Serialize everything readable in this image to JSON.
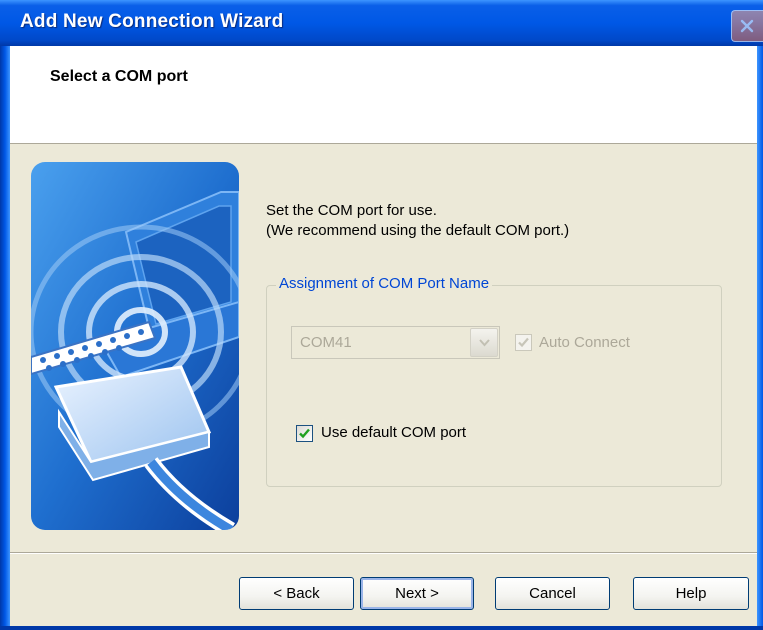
{
  "window": {
    "title": "Add New Connection Wizard",
    "accent_color": "#0058e6",
    "icons": {
      "close": "close-icon"
    }
  },
  "header": {
    "title": "Select a COM port"
  },
  "illustration": {
    "icon": "com-port-connection-icon"
  },
  "instructions": {
    "line1": "Set the COM port for use.",
    "line2": "(We recommend using the default COM port.)"
  },
  "group": {
    "label": "Assignment of COM Port Name",
    "label_color": "#0046d5",
    "com_port": {
      "selected": "COM41",
      "disabled": true
    },
    "auto_connect": {
      "label": "Auto Connect",
      "checked": true,
      "disabled": true
    },
    "use_default": {
      "label": "Use default COM port",
      "checked": true,
      "disabled": false
    }
  },
  "buttons": {
    "back": "< Back",
    "next": "Next >",
    "cancel": "Cancel",
    "help": "Help"
  }
}
